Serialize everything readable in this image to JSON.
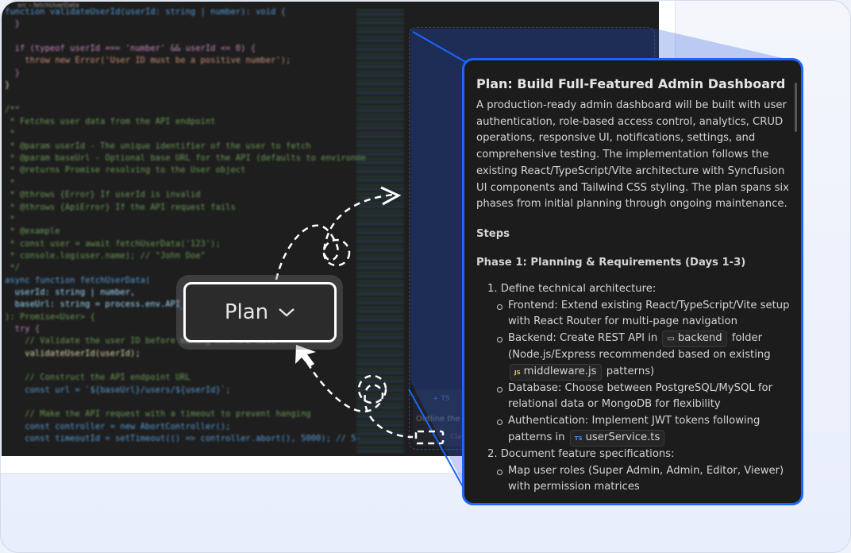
{
  "editor": {
    "breadcrumb": "src › fetchUserData",
    "code_lines": [
      {
        "t": "function validateUserId(userId: string | number): void {",
        "k": "k"
      },
      {
        "t": "  }",
        "k": "p"
      },
      {
        "t": "",
        "k": ""
      },
      {
        "t": "  if (typeof userId === 'number' && userId <= 0) {",
        "k": "p"
      },
      {
        "t": "    throw new Error('User ID must be a positive number');",
        "k": "s"
      },
      {
        "t": "  }",
        "k": "p"
      },
      {
        "t": "}",
        "k": "f"
      },
      {
        "t": "",
        "k": ""
      },
      {
        "t": "/**",
        "k": "c"
      },
      {
        "t": " * Fetches user data from the API endpoint",
        "k": "c"
      },
      {
        "t": " *",
        "k": "c"
      },
      {
        "t": " * @param userId - The unique identifier of the user to fetch",
        "k": "c"
      },
      {
        "t": " * @param baseUrl - Optional base URL for the API (defaults to environme",
        "k": "c"
      },
      {
        "t": " * @returns Promise resolving to the User object",
        "k": "c"
      },
      {
        "t": " *",
        "k": "c"
      },
      {
        "t": " * @throws {Error} If userId is invalid",
        "k": "c"
      },
      {
        "t": " * @throws {ApiError} If the API request fails",
        "k": "c"
      },
      {
        "t": " *",
        "k": "c"
      },
      {
        "t": " * @example",
        "k": "c"
      },
      {
        "t": " * const user = await fetchUserData('123');",
        "k": "c"
      },
      {
        "t": " * console.log(user.name); // \"John Doe\"",
        "k": "c"
      },
      {
        "t": " */",
        "k": "c"
      },
      {
        "t": "async function fetchUserData(",
        "k": "k"
      },
      {
        "t": "  userId: string | number,",
        "k": ""
      },
      {
        "t": "  baseUrl: string = process.env.API_BASE_URL",
        "k": ""
      },
      {
        "t": "): Promise<User> {",
        "k": "c"
      },
      {
        "t": "  try {",
        "k": "p"
      },
      {
        "t": "    // Validate the user ID before making the API call",
        "k": "c"
      },
      {
        "t": "    validateUserId(userId);",
        "k": "f"
      },
      {
        "t": "",
        "k": ""
      },
      {
        "t": "    // Construct the API endpoint URL",
        "k": "c"
      },
      {
        "t": "    const url = `${baseUrl}/users/${userId}`;",
        "k": "k"
      },
      {
        "t": "",
        "k": ""
      },
      {
        "t": "    // Make the API request with a timeout to prevent hanging",
        "k": "c"
      },
      {
        "t": "    const controller = new AbortController();",
        "k": "k"
      },
      {
        "t": "    const timeoutId = setTimeout(() => controller.abort(), 5000); // 5-",
        "k": "k"
      }
    ]
  },
  "chat_input": {
    "placeholder": "Outline the g",
    "attach_label": "+ TS",
    "model_label": "Cla"
  },
  "mode_button": {
    "label": "Plan",
    "icon": "chevron-down-icon"
  },
  "plan": {
    "title": "Plan: Build Full-Featured Admin Dashboard",
    "summary": "A production-ready admin dashboard will be built with user authentication, role-based access control, analytics, CRUD operations, responsive UI, notifications, settings, and comprehensive testing. The implementation follows the existing React/TypeScript/Vite architecture with Syncfusion UI components and Tailwind CSS styling. The plan spans six phases from initial planning through ongoing maintenance.",
    "steps_heading": "Steps",
    "phase1": "Phase 1: Planning & Requirements (Days 1-3)",
    "item1": "1. Define technical architecture:",
    "frontend": "Frontend: Extend existing React/TypeScript/Vite setup with React Router for multi-page navigation",
    "backend_pre": "Backend: Create REST API in",
    "backend_chip": "backend",
    "backend_post": "folder (Node.js/Express recommended based on existing",
    "middleware_chip": "middleware.js",
    "middleware_post": "patterns)",
    "database": "Database: Choose between PostgreSQL/MySQL for relational data or MongoDB for flexibility",
    "auth_pre": "Authentication: Implement JWT tokens following patterns in",
    "auth_chip": "userService.ts",
    "item2": "2. Document feature specifications:",
    "roles": "Map user roles (Super Admin, Admin, Editor, Viewer) with permission matrices",
    "js_badge": "JS",
    "ts_badge": "TS"
  },
  "colors": {
    "accent": "#1a66ff",
    "panel_bg": "#1c1c1c",
    "editor_bg": "#1e1e1e"
  }
}
